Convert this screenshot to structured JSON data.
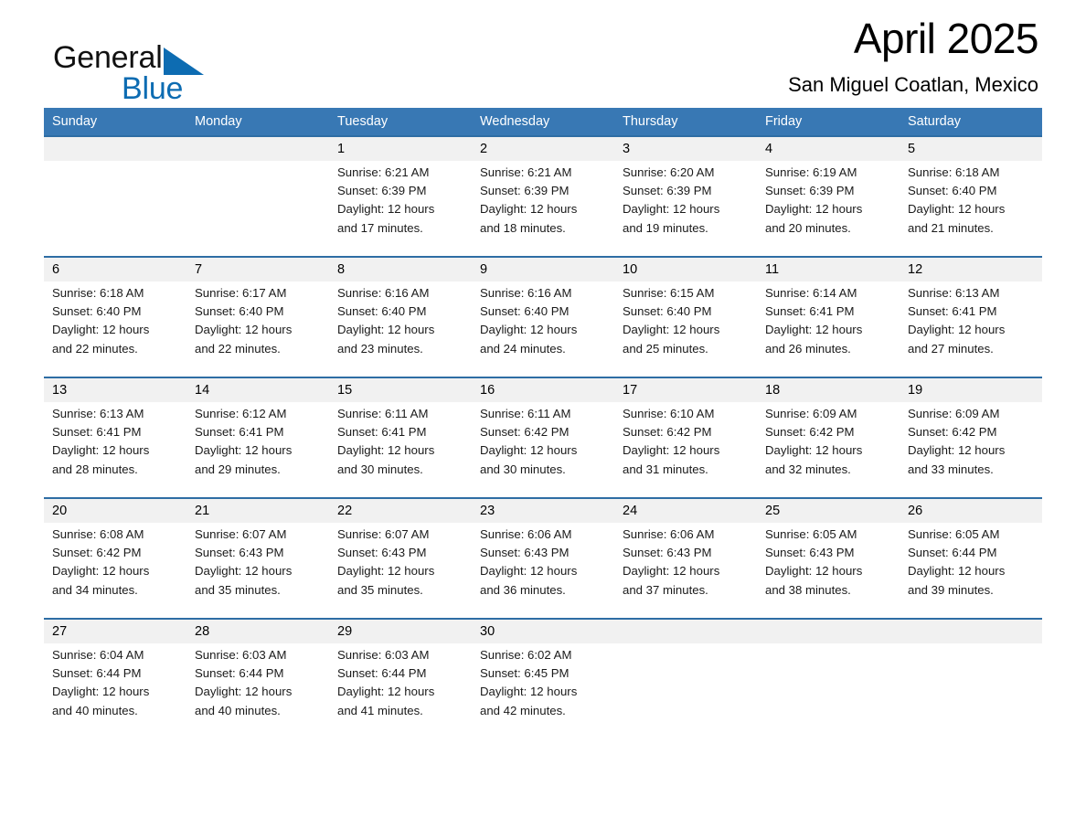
{
  "brand": {
    "name_part1": "General",
    "name_part2": "Blue",
    "triangle_color": "#0d6cb2"
  },
  "header": {
    "month_title": "April 2025",
    "location": "San Miguel Coatlan, Mexico"
  },
  "theme": {
    "header_blue": "#3878b4",
    "row_divider_blue": "#2e6da4",
    "date_band_gray": "#f1f1f1",
    "page_background": "#ffffff"
  },
  "weekdays": [
    "Sunday",
    "Monday",
    "Tuesday",
    "Wednesday",
    "Thursday",
    "Friday",
    "Saturday"
  ],
  "weeks": [
    {
      "days": [
        {
          "date": "",
          "sunrise": "",
          "sunset": "",
          "daylight_l1": "",
          "daylight_l2": ""
        },
        {
          "date": "",
          "sunrise": "",
          "sunset": "",
          "daylight_l1": "",
          "daylight_l2": ""
        },
        {
          "date": "1",
          "sunrise": "Sunrise: 6:21 AM",
          "sunset": "Sunset: 6:39 PM",
          "daylight_l1": "Daylight: 12 hours",
          "daylight_l2": "and 17 minutes."
        },
        {
          "date": "2",
          "sunrise": "Sunrise: 6:21 AM",
          "sunset": "Sunset: 6:39 PM",
          "daylight_l1": "Daylight: 12 hours",
          "daylight_l2": "and 18 minutes."
        },
        {
          "date": "3",
          "sunrise": "Sunrise: 6:20 AM",
          "sunset": "Sunset: 6:39 PM",
          "daylight_l1": "Daylight: 12 hours",
          "daylight_l2": "and 19 minutes."
        },
        {
          "date": "4",
          "sunrise": "Sunrise: 6:19 AM",
          "sunset": "Sunset: 6:39 PM",
          "daylight_l1": "Daylight: 12 hours",
          "daylight_l2": "and 20 minutes."
        },
        {
          "date": "5",
          "sunrise": "Sunrise: 6:18 AM",
          "sunset": "Sunset: 6:40 PM",
          "daylight_l1": "Daylight: 12 hours",
          "daylight_l2": "and 21 minutes."
        }
      ]
    },
    {
      "days": [
        {
          "date": "6",
          "sunrise": "Sunrise: 6:18 AM",
          "sunset": "Sunset: 6:40 PM",
          "daylight_l1": "Daylight: 12 hours",
          "daylight_l2": "and 22 minutes."
        },
        {
          "date": "7",
          "sunrise": "Sunrise: 6:17 AM",
          "sunset": "Sunset: 6:40 PM",
          "daylight_l1": "Daylight: 12 hours",
          "daylight_l2": "and 22 minutes."
        },
        {
          "date": "8",
          "sunrise": "Sunrise: 6:16 AM",
          "sunset": "Sunset: 6:40 PM",
          "daylight_l1": "Daylight: 12 hours",
          "daylight_l2": "and 23 minutes."
        },
        {
          "date": "9",
          "sunrise": "Sunrise: 6:16 AM",
          "sunset": "Sunset: 6:40 PM",
          "daylight_l1": "Daylight: 12 hours",
          "daylight_l2": "and 24 minutes."
        },
        {
          "date": "10",
          "sunrise": "Sunrise: 6:15 AM",
          "sunset": "Sunset: 6:40 PM",
          "daylight_l1": "Daylight: 12 hours",
          "daylight_l2": "and 25 minutes."
        },
        {
          "date": "11",
          "sunrise": "Sunrise: 6:14 AM",
          "sunset": "Sunset: 6:41 PM",
          "daylight_l1": "Daylight: 12 hours",
          "daylight_l2": "and 26 minutes."
        },
        {
          "date": "12",
          "sunrise": "Sunrise: 6:13 AM",
          "sunset": "Sunset: 6:41 PM",
          "daylight_l1": "Daylight: 12 hours",
          "daylight_l2": "and 27 minutes."
        }
      ]
    },
    {
      "days": [
        {
          "date": "13",
          "sunrise": "Sunrise: 6:13 AM",
          "sunset": "Sunset: 6:41 PM",
          "daylight_l1": "Daylight: 12 hours",
          "daylight_l2": "and 28 minutes."
        },
        {
          "date": "14",
          "sunrise": "Sunrise: 6:12 AM",
          "sunset": "Sunset: 6:41 PM",
          "daylight_l1": "Daylight: 12 hours",
          "daylight_l2": "and 29 minutes."
        },
        {
          "date": "15",
          "sunrise": "Sunrise: 6:11 AM",
          "sunset": "Sunset: 6:41 PM",
          "daylight_l1": "Daylight: 12 hours",
          "daylight_l2": "and 30 minutes."
        },
        {
          "date": "16",
          "sunrise": "Sunrise: 6:11 AM",
          "sunset": "Sunset: 6:42 PM",
          "daylight_l1": "Daylight: 12 hours",
          "daylight_l2": "and 30 minutes."
        },
        {
          "date": "17",
          "sunrise": "Sunrise: 6:10 AM",
          "sunset": "Sunset: 6:42 PM",
          "daylight_l1": "Daylight: 12 hours",
          "daylight_l2": "and 31 minutes."
        },
        {
          "date": "18",
          "sunrise": "Sunrise: 6:09 AM",
          "sunset": "Sunset: 6:42 PM",
          "daylight_l1": "Daylight: 12 hours",
          "daylight_l2": "and 32 minutes."
        },
        {
          "date": "19",
          "sunrise": "Sunrise: 6:09 AM",
          "sunset": "Sunset: 6:42 PM",
          "daylight_l1": "Daylight: 12 hours",
          "daylight_l2": "and 33 minutes."
        }
      ]
    },
    {
      "days": [
        {
          "date": "20",
          "sunrise": "Sunrise: 6:08 AM",
          "sunset": "Sunset: 6:42 PM",
          "daylight_l1": "Daylight: 12 hours",
          "daylight_l2": "and 34 minutes."
        },
        {
          "date": "21",
          "sunrise": "Sunrise: 6:07 AM",
          "sunset": "Sunset: 6:43 PM",
          "daylight_l1": "Daylight: 12 hours",
          "daylight_l2": "and 35 minutes."
        },
        {
          "date": "22",
          "sunrise": "Sunrise: 6:07 AM",
          "sunset": "Sunset: 6:43 PM",
          "daylight_l1": "Daylight: 12 hours",
          "daylight_l2": "and 35 minutes."
        },
        {
          "date": "23",
          "sunrise": "Sunrise: 6:06 AM",
          "sunset": "Sunset: 6:43 PM",
          "daylight_l1": "Daylight: 12 hours",
          "daylight_l2": "and 36 minutes."
        },
        {
          "date": "24",
          "sunrise": "Sunrise: 6:06 AM",
          "sunset": "Sunset: 6:43 PM",
          "daylight_l1": "Daylight: 12 hours",
          "daylight_l2": "and 37 minutes."
        },
        {
          "date": "25",
          "sunrise": "Sunrise: 6:05 AM",
          "sunset": "Sunset: 6:43 PM",
          "daylight_l1": "Daylight: 12 hours",
          "daylight_l2": "and 38 minutes."
        },
        {
          "date": "26",
          "sunrise": "Sunrise: 6:05 AM",
          "sunset": "Sunset: 6:44 PM",
          "daylight_l1": "Daylight: 12 hours",
          "daylight_l2": "and 39 minutes."
        }
      ]
    },
    {
      "days": [
        {
          "date": "27",
          "sunrise": "Sunrise: 6:04 AM",
          "sunset": "Sunset: 6:44 PM",
          "daylight_l1": "Daylight: 12 hours",
          "daylight_l2": "and 40 minutes."
        },
        {
          "date": "28",
          "sunrise": "Sunrise: 6:03 AM",
          "sunset": "Sunset: 6:44 PM",
          "daylight_l1": "Daylight: 12 hours",
          "daylight_l2": "and 40 minutes."
        },
        {
          "date": "29",
          "sunrise": "Sunrise: 6:03 AM",
          "sunset": "Sunset: 6:44 PM",
          "daylight_l1": "Daylight: 12 hours",
          "daylight_l2": "and 41 minutes."
        },
        {
          "date": "30",
          "sunrise": "Sunrise: 6:02 AM",
          "sunset": "Sunset: 6:45 PM",
          "daylight_l1": "Daylight: 12 hours",
          "daylight_l2": "and 42 minutes."
        },
        {
          "date": "",
          "sunrise": "",
          "sunset": "",
          "daylight_l1": "",
          "daylight_l2": ""
        },
        {
          "date": "",
          "sunrise": "",
          "sunset": "",
          "daylight_l1": "",
          "daylight_l2": ""
        },
        {
          "date": "",
          "sunrise": "",
          "sunset": "",
          "daylight_l1": "",
          "daylight_l2": ""
        }
      ]
    }
  ]
}
